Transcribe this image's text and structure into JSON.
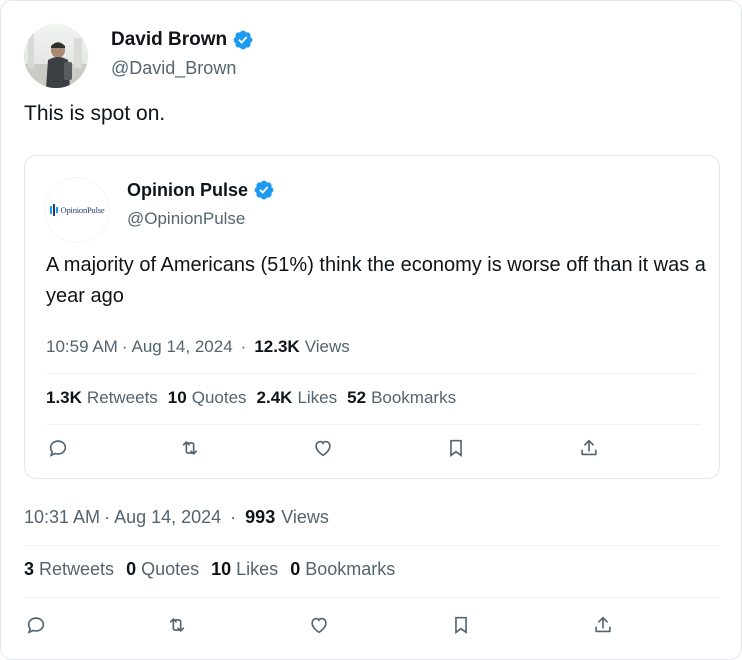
{
  "author": {
    "display_name": "David Brown",
    "handle": "@David_Brown",
    "verified": true
  },
  "tweet": {
    "text": "This is spot on.",
    "time": "10:31 AM",
    "date": "Aug 14, 2024",
    "views_count": "993",
    "views_label": "Views",
    "stats": [
      {
        "count": "3",
        "label": "Retweets"
      },
      {
        "count": "0",
        "label": "Quotes"
      },
      {
        "count": "10",
        "label": "Likes"
      },
      {
        "count": "0",
        "label": "Bookmarks"
      }
    ]
  },
  "quoted": {
    "display_name": "Opinion Pulse",
    "handle": "@OpinionPulse",
    "verified": true,
    "avatar_logo_text": "OpinionPulse",
    "text": "A majority of Americans (51%) think the economy is worse off than it was a year ago",
    "time": "10:59 AM",
    "date": "Aug 14, 2024",
    "views_count": "12.3K",
    "views_label": "Views",
    "stats": [
      {
        "count": "1.3K",
        "label": "Retweets"
      },
      {
        "count": "10",
        "label": "Quotes"
      },
      {
        "count": "2.4K",
        "label": "Likes"
      },
      {
        "count": "52",
        "label": "Bookmarks"
      }
    ]
  },
  "separators": {
    "meta_sep": "·",
    "views_sep": "·"
  },
  "actions": [
    "reply-icon",
    "retweet-icon",
    "like-icon",
    "bookmark-icon",
    "share-icon"
  ],
  "colors": {
    "verified_blue": "#1d9bf0",
    "secondary_text": "#536471",
    "primary_text": "#0f1419",
    "border": "#e1e8ed"
  }
}
